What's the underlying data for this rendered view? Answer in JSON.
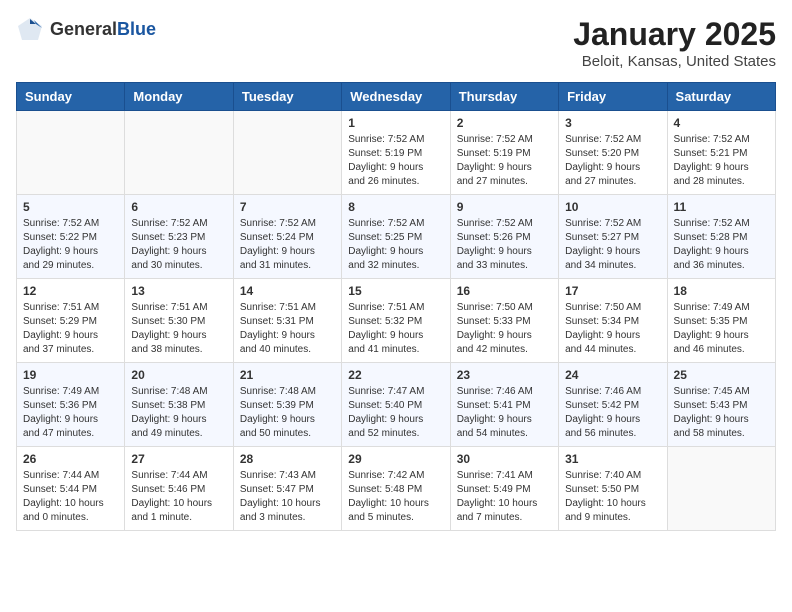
{
  "header": {
    "logo_general": "General",
    "logo_blue": "Blue",
    "title": "January 2025",
    "subtitle": "Beloit, Kansas, United States"
  },
  "days_of_week": [
    "Sunday",
    "Monday",
    "Tuesday",
    "Wednesday",
    "Thursday",
    "Friday",
    "Saturday"
  ],
  "weeks": [
    [
      {
        "day": "",
        "info": ""
      },
      {
        "day": "",
        "info": ""
      },
      {
        "day": "",
        "info": ""
      },
      {
        "day": "1",
        "info": "Sunrise: 7:52 AM\nSunset: 5:19 PM\nDaylight: 9 hours\nand 26 minutes."
      },
      {
        "day": "2",
        "info": "Sunrise: 7:52 AM\nSunset: 5:19 PM\nDaylight: 9 hours\nand 27 minutes."
      },
      {
        "day": "3",
        "info": "Sunrise: 7:52 AM\nSunset: 5:20 PM\nDaylight: 9 hours\nand 27 minutes."
      },
      {
        "day": "4",
        "info": "Sunrise: 7:52 AM\nSunset: 5:21 PM\nDaylight: 9 hours\nand 28 minutes."
      }
    ],
    [
      {
        "day": "5",
        "info": "Sunrise: 7:52 AM\nSunset: 5:22 PM\nDaylight: 9 hours\nand 29 minutes."
      },
      {
        "day": "6",
        "info": "Sunrise: 7:52 AM\nSunset: 5:23 PM\nDaylight: 9 hours\nand 30 minutes."
      },
      {
        "day": "7",
        "info": "Sunrise: 7:52 AM\nSunset: 5:24 PM\nDaylight: 9 hours\nand 31 minutes."
      },
      {
        "day": "8",
        "info": "Sunrise: 7:52 AM\nSunset: 5:25 PM\nDaylight: 9 hours\nand 32 minutes."
      },
      {
        "day": "9",
        "info": "Sunrise: 7:52 AM\nSunset: 5:26 PM\nDaylight: 9 hours\nand 33 minutes."
      },
      {
        "day": "10",
        "info": "Sunrise: 7:52 AM\nSunset: 5:27 PM\nDaylight: 9 hours\nand 34 minutes."
      },
      {
        "day": "11",
        "info": "Sunrise: 7:52 AM\nSunset: 5:28 PM\nDaylight: 9 hours\nand 36 minutes."
      }
    ],
    [
      {
        "day": "12",
        "info": "Sunrise: 7:51 AM\nSunset: 5:29 PM\nDaylight: 9 hours\nand 37 minutes."
      },
      {
        "day": "13",
        "info": "Sunrise: 7:51 AM\nSunset: 5:30 PM\nDaylight: 9 hours\nand 38 minutes."
      },
      {
        "day": "14",
        "info": "Sunrise: 7:51 AM\nSunset: 5:31 PM\nDaylight: 9 hours\nand 40 minutes."
      },
      {
        "day": "15",
        "info": "Sunrise: 7:51 AM\nSunset: 5:32 PM\nDaylight: 9 hours\nand 41 minutes."
      },
      {
        "day": "16",
        "info": "Sunrise: 7:50 AM\nSunset: 5:33 PM\nDaylight: 9 hours\nand 42 minutes."
      },
      {
        "day": "17",
        "info": "Sunrise: 7:50 AM\nSunset: 5:34 PM\nDaylight: 9 hours\nand 44 minutes."
      },
      {
        "day": "18",
        "info": "Sunrise: 7:49 AM\nSunset: 5:35 PM\nDaylight: 9 hours\nand 46 minutes."
      }
    ],
    [
      {
        "day": "19",
        "info": "Sunrise: 7:49 AM\nSunset: 5:36 PM\nDaylight: 9 hours\nand 47 minutes."
      },
      {
        "day": "20",
        "info": "Sunrise: 7:48 AM\nSunset: 5:38 PM\nDaylight: 9 hours\nand 49 minutes."
      },
      {
        "day": "21",
        "info": "Sunrise: 7:48 AM\nSunset: 5:39 PM\nDaylight: 9 hours\nand 50 minutes."
      },
      {
        "day": "22",
        "info": "Sunrise: 7:47 AM\nSunset: 5:40 PM\nDaylight: 9 hours\nand 52 minutes."
      },
      {
        "day": "23",
        "info": "Sunrise: 7:46 AM\nSunset: 5:41 PM\nDaylight: 9 hours\nand 54 minutes."
      },
      {
        "day": "24",
        "info": "Sunrise: 7:46 AM\nSunset: 5:42 PM\nDaylight: 9 hours\nand 56 minutes."
      },
      {
        "day": "25",
        "info": "Sunrise: 7:45 AM\nSunset: 5:43 PM\nDaylight: 9 hours\nand 58 minutes."
      }
    ],
    [
      {
        "day": "26",
        "info": "Sunrise: 7:44 AM\nSunset: 5:44 PM\nDaylight: 10 hours\nand 0 minutes."
      },
      {
        "day": "27",
        "info": "Sunrise: 7:44 AM\nSunset: 5:46 PM\nDaylight: 10 hours\nand 1 minute."
      },
      {
        "day": "28",
        "info": "Sunrise: 7:43 AM\nSunset: 5:47 PM\nDaylight: 10 hours\nand 3 minutes."
      },
      {
        "day": "29",
        "info": "Sunrise: 7:42 AM\nSunset: 5:48 PM\nDaylight: 10 hours\nand 5 minutes."
      },
      {
        "day": "30",
        "info": "Sunrise: 7:41 AM\nSunset: 5:49 PM\nDaylight: 10 hours\nand 7 minutes."
      },
      {
        "day": "31",
        "info": "Sunrise: 7:40 AM\nSunset: 5:50 PM\nDaylight: 10 hours\nand 9 minutes."
      },
      {
        "day": "",
        "info": ""
      }
    ]
  ]
}
